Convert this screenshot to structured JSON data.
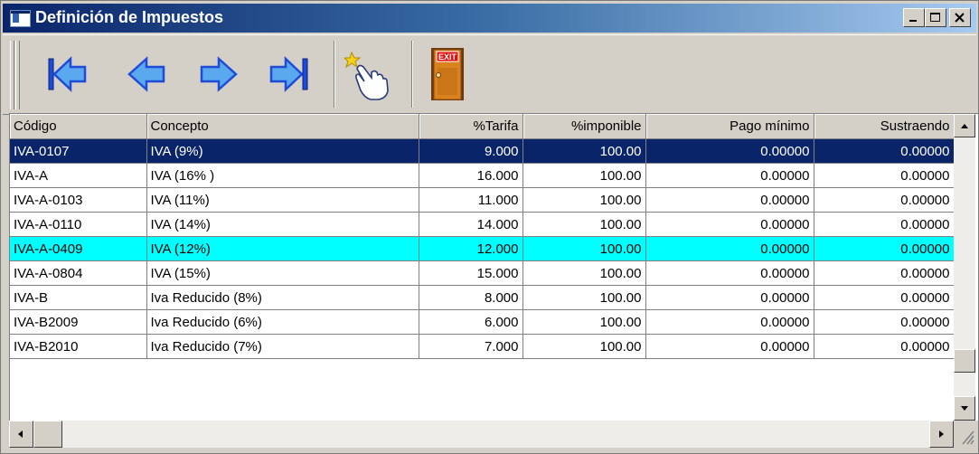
{
  "window": {
    "title": "Definición de Impuestos",
    "accent_color": "#0a246a",
    "highlight_color": "#00ffff"
  },
  "toolbar": {
    "buttons": [
      {
        "name": "first-record",
        "icon": "arrow-first-icon"
      },
      {
        "name": "previous-record",
        "icon": "arrow-left-icon"
      },
      {
        "name": "next-record",
        "icon": "arrow-right-icon"
      },
      {
        "name": "last-record",
        "icon": "arrow-last-icon"
      },
      {
        "name": "select",
        "icon": "pointing-hand-icon"
      },
      {
        "name": "exit",
        "icon": "exit-door-icon",
        "label": "EXIT"
      }
    ]
  },
  "grid": {
    "columns": [
      "Código",
      "Concepto",
      "%Tarifa",
      "%imponible",
      "Pago mínimo",
      "Sustraendo"
    ],
    "rows": [
      [
        "IVA-0107",
        "IVA (9%)",
        "9.000",
        "100.00",
        "0.00000",
        "0.00000"
      ],
      [
        "IVA-A",
        "IVA (16% )",
        "16.000",
        "100.00",
        "0.00000",
        "0.00000"
      ],
      [
        "IVA-A-0103",
        "IVA (11%)",
        "11.000",
        "100.00",
        "0.00000",
        "0.00000"
      ],
      [
        "IVA-A-0110",
        "IVA (14%)",
        "14.000",
        "100.00",
        "0.00000",
        "0.00000"
      ],
      [
        "IVA-A-0409",
        "IVA (12%)",
        "12.000",
        "100.00",
        "0.00000",
        "0.00000"
      ],
      [
        "IVA-A-0804",
        "IVA (15%)",
        "15.000",
        "100.00",
        "0.00000",
        "0.00000"
      ],
      [
        "IVA-B",
        "Iva Reducido (8%)",
        "8.000",
        "100.00",
        "0.00000",
        "0.00000"
      ],
      [
        "IVA-B2009",
        "Iva Reducido (6%)",
        "6.000",
        "100.00",
        "0.00000",
        "0.00000"
      ],
      [
        "IVA-B2010",
        "Iva Reducido (7%)",
        "7.000",
        "100.00",
        "0.00000",
        "0.00000"
      ]
    ],
    "selected_row": 0,
    "highlighted_row": 4
  }
}
